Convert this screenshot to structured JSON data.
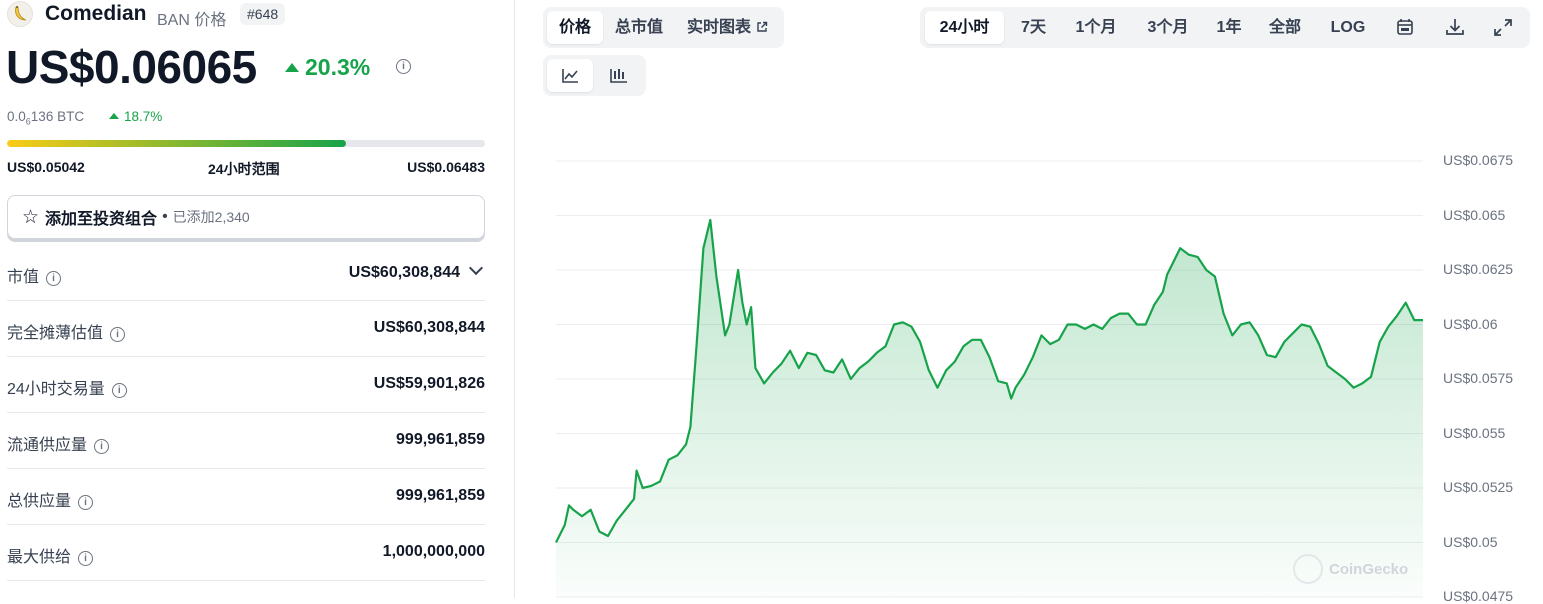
{
  "coin": {
    "name": "Comedian",
    "symbol_label": "BAN 价格",
    "rank": "#648",
    "price": "US$0.06065",
    "change_24h": "20.3%",
    "btc_price_prefix": "0.0",
    "btc_price_sub": "6",
    "btc_price_rest": "136 BTC",
    "btc_change": "18.7%"
  },
  "range_24h": {
    "low": "US$0.05042",
    "label": "24小时范围",
    "high": "US$0.06483",
    "position": 0.71
  },
  "portfolio": {
    "label": "添加至投资组合",
    "added": "已添加2,340"
  },
  "stats": [
    {
      "label": "市值",
      "value": "US$60,308,844"
    },
    {
      "label": "完全摊薄估值",
      "value": "US$60,308,844"
    },
    {
      "label": "24小时交易量",
      "value": "US$59,901,826"
    },
    {
      "label": "流通供应量",
      "value": "999,961,859"
    },
    {
      "label": "总供应量",
      "value": "999,961,859"
    },
    {
      "label": "最大供给",
      "value": "1,000,000,000"
    }
  ],
  "chart_tabs": [
    "价格",
    "总市值",
    "实时图表"
  ],
  "time_ranges": [
    "24小时",
    "7天",
    "1个月",
    "3个月",
    "1年",
    "全部",
    "LOG"
  ],
  "icons": {
    "calendar": "calendar-icon",
    "download": "download-icon",
    "fullscreen": "expand-icon",
    "line_chart": "line-chart-icon",
    "candle_chart": "candlestick-icon"
  },
  "watermark": "CoinGecko",
  "colors": {
    "up": "#16a34a",
    "line": "#16a34a",
    "range_start": "#facc15",
    "range_end": "#16a34a"
  },
  "chart_data": {
    "type": "area",
    "y_tick_labels": [
      "US$0.0675",
      "US$0.065",
      "US$0.0625",
      "US$0.06",
      "US$0.0575",
      "US$0.055",
      "US$0.0525",
      "US$0.05",
      "US$0.0475"
    ],
    "y_ticks": [
      0.0675,
      0.065,
      0.0625,
      0.06,
      0.0575,
      0.055,
      0.0525,
      0.05,
      0.0475
    ],
    "ylim": [
      0.0475,
      0.0675
    ],
    "x_index_range": [
      0,
      100
    ],
    "grid": true,
    "points": [
      [
        0,
        0.05
      ],
      [
        1,
        0.0508
      ],
      [
        1.5,
        0.0517
      ],
      [
        2,
        0.0515
      ],
      [
        3,
        0.0512
      ],
      [
        4,
        0.0515
      ],
      [
        5,
        0.0505
      ],
      [
        6,
        0.0503
      ],
      [
        7,
        0.051
      ],
      [
        8,
        0.0515
      ],
      [
        9,
        0.052
      ],
      [
        9.3,
        0.0533
      ],
      [
        10,
        0.0525
      ],
      [
        11,
        0.0526
      ],
      [
        12,
        0.0528
      ],
      [
        13,
        0.0538
      ],
      [
        14,
        0.054
      ],
      [
        15,
        0.0545
      ],
      [
        15.5,
        0.0553
      ],
      [
        16.2,
        0.059
      ],
      [
        17,
        0.0635
      ],
      [
        17.8,
        0.0648
      ],
      [
        18.5,
        0.0622
      ],
      [
        19.5,
        0.0595
      ],
      [
        20,
        0.06
      ],
      [
        21,
        0.0625
      ],
      [
        21.5,
        0.061
      ],
      [
        22,
        0.06
      ],
      [
        22.5,
        0.0608
      ],
      [
        23,
        0.058
      ],
      [
        24,
        0.0573
      ],
      [
        25,
        0.0578
      ],
      [
        26,
        0.0582
      ],
      [
        27,
        0.0588
      ],
      [
        28,
        0.058
      ],
      [
        29,
        0.0587
      ],
      [
        30,
        0.0586
      ],
      [
        31,
        0.0579
      ],
      [
        32,
        0.0578
      ],
      [
        33,
        0.0584
      ],
      [
        34,
        0.0575
      ],
      [
        35,
        0.058
      ],
      [
        36,
        0.0583
      ],
      [
        37,
        0.0587
      ],
      [
        38,
        0.059
      ],
      [
        39,
        0.06
      ],
      [
        40,
        0.0601
      ],
      [
        41,
        0.0599
      ],
      [
        42,
        0.0592
      ],
      [
        43,
        0.0579
      ],
      [
        44,
        0.0571
      ],
      [
        45,
        0.0579
      ],
      [
        46,
        0.0583
      ],
      [
        47,
        0.059
      ],
      [
        48,
        0.0593
      ],
      [
        49,
        0.0593
      ],
      [
        50,
        0.0585
      ],
      [
        51,
        0.0574
      ],
      [
        52,
        0.0573
      ],
      [
        52.5,
        0.0566
      ],
      [
        53,
        0.0571
      ],
      [
        54,
        0.0577
      ],
      [
        55,
        0.0585
      ],
      [
        56,
        0.0595
      ],
      [
        57,
        0.0591
      ],
      [
        58,
        0.0593
      ],
      [
        59,
        0.06
      ],
      [
        60,
        0.06
      ],
      [
        61,
        0.0598
      ],
      [
        62,
        0.06
      ],
      [
        63,
        0.0598
      ],
      [
        64,
        0.0603
      ],
      [
        65,
        0.0605
      ],
      [
        66,
        0.0605
      ],
      [
        67,
        0.06
      ],
      [
        68,
        0.06
      ],
      [
        69,
        0.0609
      ],
      [
        70,
        0.0615
      ],
      [
        70.5,
        0.0623
      ],
      [
        71,
        0.0627
      ],
      [
        72,
        0.0635
      ],
      [
        73,
        0.0632
      ],
      [
        74,
        0.0631
      ],
      [
        75,
        0.0625
      ],
      [
        76,
        0.0622
      ],
      [
        77,
        0.0605
      ],
      [
        78,
        0.0595
      ],
      [
        79,
        0.06
      ],
      [
        80,
        0.0601
      ],
      [
        81,
        0.0595
      ],
      [
        82,
        0.0586
      ],
      [
        83,
        0.0585
      ],
      [
        84,
        0.0592
      ],
      [
        85,
        0.0596
      ],
      [
        86,
        0.06
      ],
      [
        87,
        0.0599
      ],
      [
        88,
        0.0591
      ],
      [
        89,
        0.0581
      ],
      [
        90,
        0.0578
      ],
      [
        91,
        0.0575
      ],
      [
        92,
        0.0571
      ],
      [
        93,
        0.0573
      ],
      [
        94,
        0.0576
      ],
      [
        95,
        0.0592
      ],
      [
        96,
        0.0599
      ],
      [
        97,
        0.0604
      ],
      [
        98,
        0.061
      ],
      [
        99,
        0.0602
      ],
      [
        100,
        0.0602
      ]
    ]
  }
}
